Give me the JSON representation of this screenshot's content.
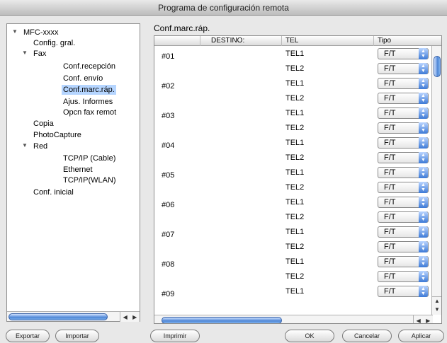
{
  "window": {
    "title": "Programa de configuración remota"
  },
  "tree": {
    "items": [
      {
        "label": "MFC-xxxx",
        "expanded": true
      },
      {
        "label": "Config. gral."
      },
      {
        "label": "Fax",
        "expanded": true
      },
      {
        "label": "Conf.recepción"
      },
      {
        "label": "Conf. envío"
      },
      {
        "label": "Conf.marc.ráp.",
        "selected": true
      },
      {
        "label": "Ajus. Informes"
      },
      {
        "label": "Opcn fax remot"
      },
      {
        "label": "Copia"
      },
      {
        "label": "PhotoCapture"
      },
      {
        "label": "Red",
        "expanded": true
      },
      {
        "label": "TCP/IP (Cable)"
      },
      {
        "label": "Ethernet"
      },
      {
        "label": "TCP/IP(WLAN)"
      },
      {
        "label": "Conf. inicial"
      }
    ]
  },
  "panel": {
    "title": "Conf.marc.ráp.",
    "columns": {
      "destino": "DESTINO:",
      "tel": "TEL",
      "tipo": "Tipo"
    },
    "rows": [
      {
        "id": "#01",
        "tel1": "TEL1",
        "tel2": "TEL2",
        "tipo1": "F/T",
        "tipo2": "F/T"
      },
      {
        "id": "#02",
        "tel1": "TEL1",
        "tel2": "TEL2",
        "tipo1": "F/T",
        "tipo2": "F/T"
      },
      {
        "id": "#03",
        "tel1": "TEL1",
        "tel2": "TEL2",
        "tipo1": "F/T",
        "tipo2": "F/T"
      },
      {
        "id": "#04",
        "tel1": "TEL1",
        "tel2": "TEL2",
        "tipo1": "F/T",
        "tipo2": "F/T"
      },
      {
        "id": "#05",
        "tel1": "TEL1",
        "tel2": "TEL2",
        "tipo1": "F/T",
        "tipo2": "F/T"
      },
      {
        "id": "#06",
        "tel1": "TEL1",
        "tel2": "TEL2",
        "tipo1": "F/T",
        "tipo2": "F/T"
      },
      {
        "id": "#07",
        "tel1": "TEL1",
        "tel2": "TEL2",
        "tipo1": "F/T",
        "tipo2": "F/T"
      },
      {
        "id": "#08",
        "tel1": "TEL1",
        "tel2": "TEL2",
        "tipo1": "F/T",
        "tipo2": "F/T"
      },
      {
        "id": "#09",
        "tel1": "TEL1",
        "tel2": "",
        "tipo1": "F/T",
        "tipo2": ""
      }
    ]
  },
  "buttons": {
    "exportar": "Exportar",
    "importar": "Importar",
    "imprimir": "Imprimir",
    "ok": "OK",
    "cancelar": "Cancelar",
    "aplicar": "Aplicar"
  },
  "icons": {
    "stepper": "up-down-arrows-icon",
    "tree_expanded": "disclosure-triangle-down-icon",
    "scroll_left": "arrow-left-icon",
    "scroll_right": "arrow-right-icon",
    "scroll_up": "arrow-up-icon",
    "scroll_down": "arrow-down-icon"
  },
  "colors": {
    "selection": "#b5d5ff",
    "accent": "#4e86d6"
  }
}
